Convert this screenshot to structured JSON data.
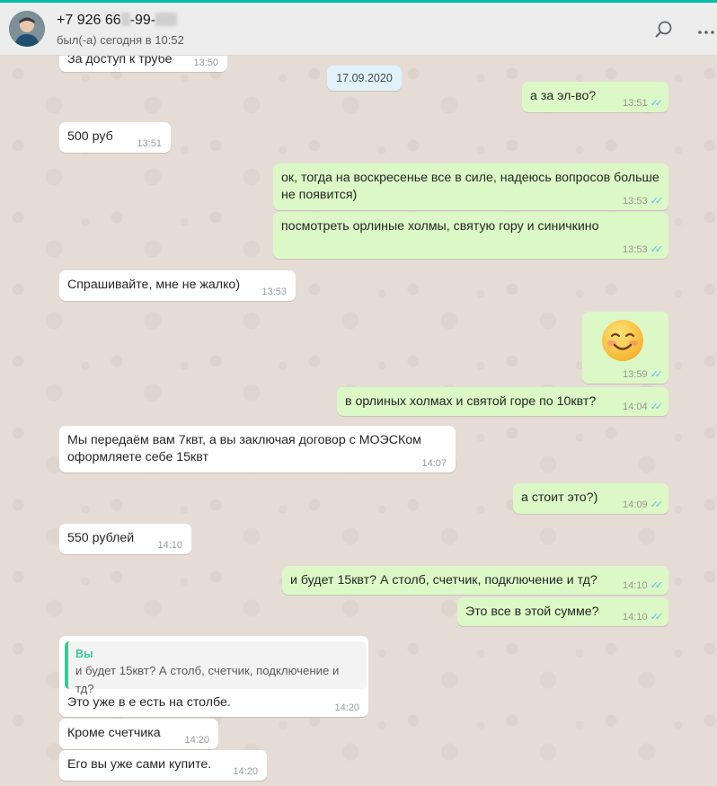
{
  "header": {
    "name_prefix": "+7 926 66",
    "name_mid": "-99-",
    "status": "был(-а) сегодня в 10:52"
  },
  "colors": {
    "accent": "#00bfa5",
    "incoming": "#ffffff",
    "outgoing": "#dcf8c6",
    "read_ticks": "#4fc3f7"
  },
  "chat": {
    "date": "17.09.2020",
    "messages": [
      {
        "dir": "in",
        "text": "За доступ к трубе",
        "time": "13:50"
      },
      {
        "dir": "out",
        "text": "а за эл-во?",
        "time": "13:51",
        "ticks": "✓✓"
      },
      {
        "dir": "in",
        "text": "500 руб",
        "time": "13:51"
      },
      {
        "dir": "out",
        "text": "ок, тогда на воскресенье все в силе, надеюсь вопросов больше не появится)",
        "time": "13:53",
        "ticks": "✓✓"
      },
      {
        "dir": "out",
        "text": "посмотреть орлиные холмы, святую гору и синичкино",
        "time": "13:53",
        "ticks": "✓✓"
      },
      {
        "dir": "in",
        "text": "Спрашивайте, мне не жалко)",
        "time": "13:53"
      },
      {
        "dir": "out",
        "text": "☺",
        "time": "13:59",
        "ticks": "✓✓"
      },
      {
        "dir": "out",
        "text": "в орлиных холмах и святой горе по 10квт?",
        "time": "14:04",
        "ticks": "✓✓"
      },
      {
        "dir": "in",
        "text": "Мы передаём вам 7квт, а вы заключая договор с МОЭСКом оформляете себе 15квт",
        "time": "14:07"
      },
      {
        "dir": "out",
        "text": "а стоит это?)",
        "time": "14:09",
        "ticks": "✓✓"
      },
      {
        "dir": "in",
        "text": "550 рублей",
        "time": "14:10"
      },
      {
        "dir": "out",
        "text": "и будет 15квт? А столб, счетчик, подключение и тд?",
        "time": "14:10",
        "ticks": "✓✓"
      },
      {
        "dir": "out",
        "text": "Это все в этой сумме?",
        "time": "14:10",
        "ticks": "✓✓"
      },
      {
        "dir": "in",
        "quote_author": "Вы",
        "quote_text": "и будет 15квт? А столб, счетчик, подключение и тд?",
        "text": "Это уже в е есть на столбе.",
        "time": "14:20"
      },
      {
        "dir": "in",
        "text": "Кроме счетчика",
        "time": "14:20"
      },
      {
        "dir": "in",
        "text": "Его вы уже сами купите.",
        "time": "14:20"
      }
    ]
  }
}
